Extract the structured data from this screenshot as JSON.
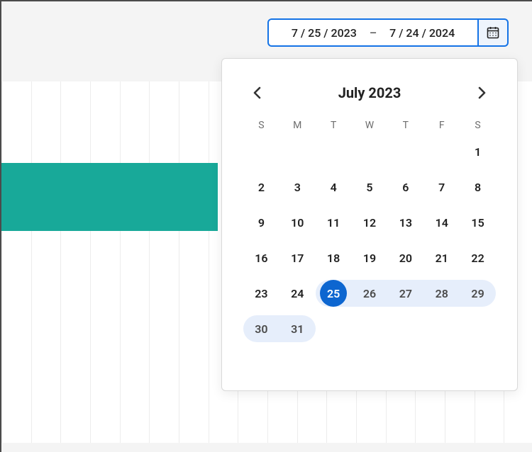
{
  "date_field": {
    "start": "7 / 25 / 2023",
    "dash": "–",
    "end": "7 / 24 / 2024"
  },
  "calendar": {
    "title": "July 2023",
    "dow": [
      "S",
      "M",
      "T",
      "W",
      "T",
      "F",
      "S"
    ],
    "selected_day": 25,
    "range_days": [
      25,
      26,
      27,
      28,
      29,
      30,
      31
    ],
    "weeks": [
      [
        null,
        null,
        null,
        null,
        null,
        null,
        1
      ],
      [
        2,
        3,
        4,
        5,
        6,
        7,
        8
      ],
      [
        9,
        10,
        11,
        12,
        13,
        14,
        15
      ],
      [
        16,
        17,
        18,
        19,
        20,
        21,
        22
      ],
      [
        23,
        24,
        25,
        26,
        27,
        28,
        29
      ],
      [
        30,
        31,
        null,
        null,
        null,
        null,
        null
      ]
    ]
  }
}
